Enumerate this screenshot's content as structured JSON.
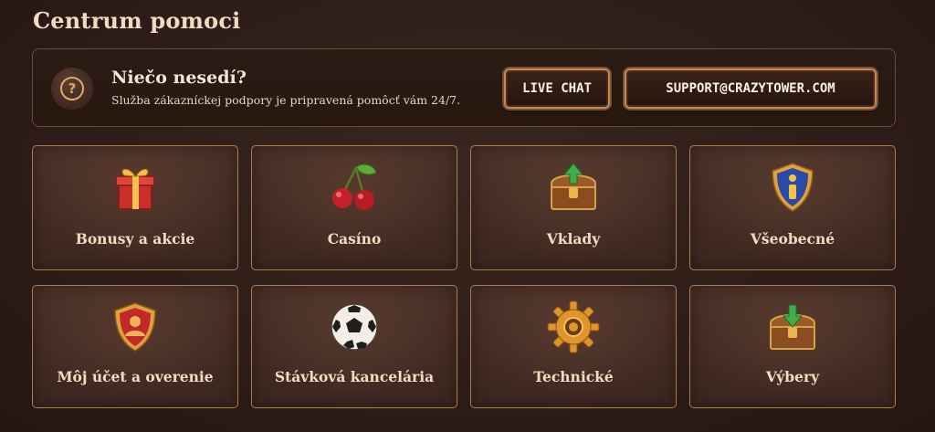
{
  "page": {
    "title": "Centrum pomoci"
  },
  "banner": {
    "heading": "Niečo nesedí?",
    "subtext": "Služba zákazníckej podpory je pripravená pomôcť vám 24/7.",
    "help_icon": "question-icon",
    "live_chat_label": "LIVE CHAT",
    "support_email_label": "SUPPORT@CRAZYTOWER.COM"
  },
  "categories": [
    {
      "label": "Bonusy a akcie",
      "icon": "gift-icon"
    },
    {
      "label": "Casíno",
      "icon": "cherries-icon"
    },
    {
      "label": "Vklady",
      "icon": "treasure-chest-deposit-icon"
    },
    {
      "label": "Všeobecné",
      "icon": "info-shield-icon"
    },
    {
      "label": "Môj účet a overenie",
      "icon": "user-shield-icon"
    },
    {
      "label": "Stávková kancelária",
      "icon": "soccer-ball-icon"
    },
    {
      "label": "Technické",
      "icon": "gear-icon"
    },
    {
      "label": "Výbery",
      "icon": "treasure-chest-withdraw-icon"
    }
  ],
  "colors": {
    "background": "#2e1d18",
    "card_border": "#b07b52",
    "accent_gold": "#e0a960"
  }
}
